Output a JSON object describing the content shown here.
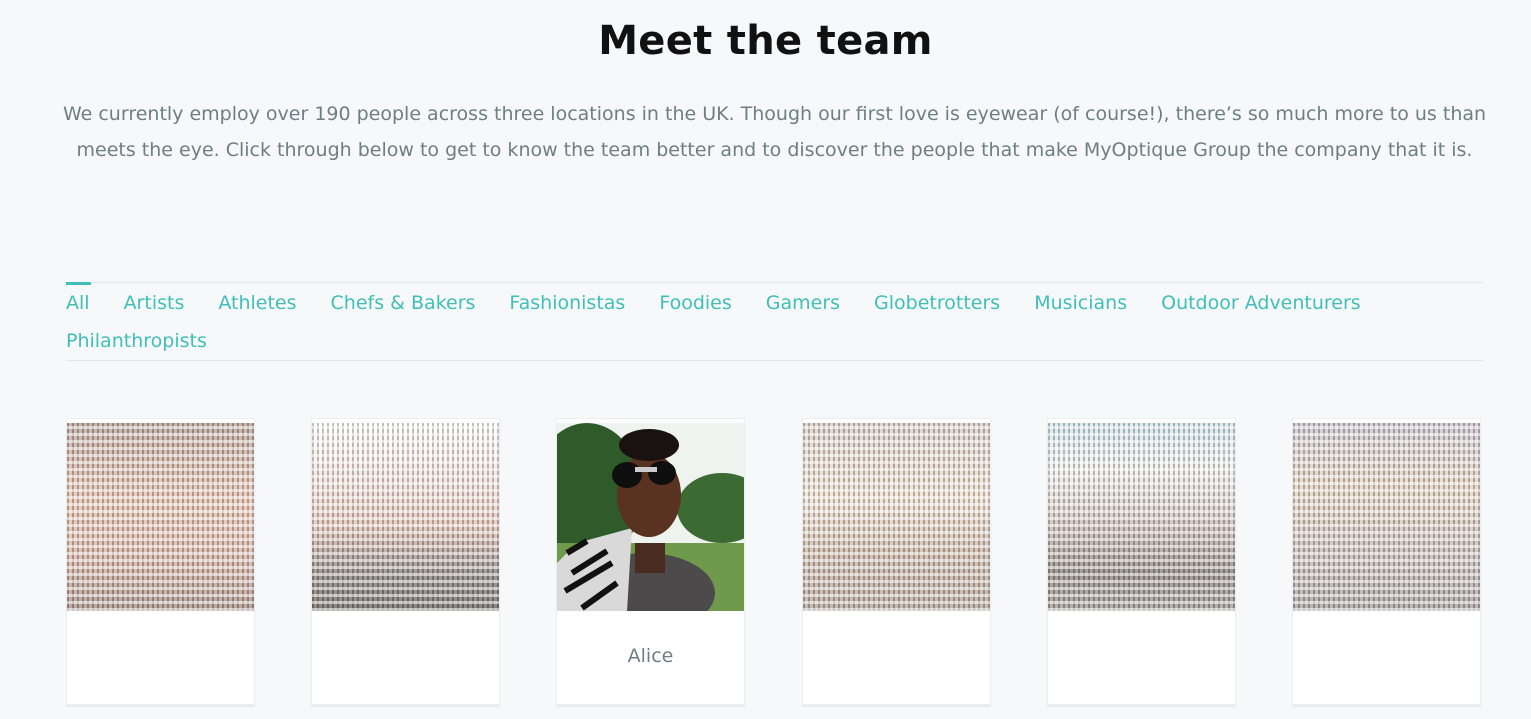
{
  "header": {
    "title": "Meet the team",
    "intro": "We currently employ over 190 people across three locations in the UK. Though our first love is eyewear (of course!), there’s so much more to us than meets the eye. Click through below to get to know the team better and to discover the people that make MyOptique Group the company that it is."
  },
  "tabs": {
    "row1": [
      "All",
      "Artists",
      "Athletes",
      "Chefs & Bakers",
      "Fashionistas",
      "Foodies",
      "Gamers",
      "Globetrotters",
      "Musicians",
      "Outdoor Adventurers"
    ],
    "row2": [
      "Philanthropists"
    ],
    "active": "All"
  },
  "team": [
    {
      "name": ""
    },
    {
      "name": ""
    },
    {
      "name": "Alice"
    },
    {
      "name": ""
    },
    {
      "name": ""
    },
    {
      "name": ""
    }
  ],
  "colors": {
    "accent": "#3fbfb8",
    "text_muted": "#6d7f82",
    "background": "#f7f8fa"
  }
}
